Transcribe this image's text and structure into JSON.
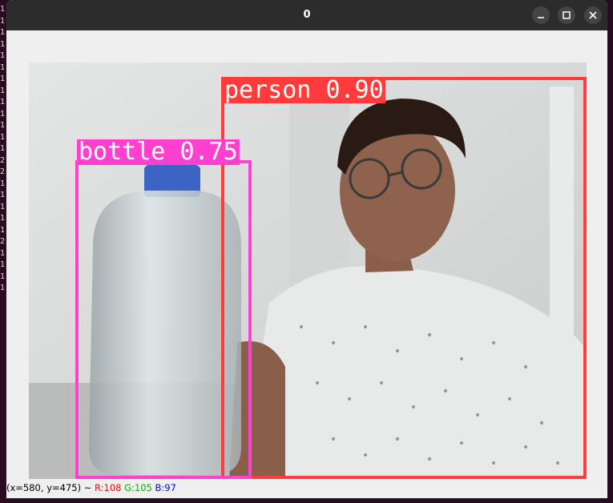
{
  "window": {
    "title": "0"
  },
  "terminal": {
    "lines": [
      "1",
      "1",
      "1",
      "1",
      "1",
      "1",
      "1",
      "1",
      "1",
      "1",
      "1",
      "1",
      "1",
      "2",
      "2",
      "1",
      "1",
      "1",
      "1",
      "1",
      "2",
      "1",
      "1",
      "1",
      "1"
    ]
  },
  "detections": [
    {
      "label": "person",
      "score": "0.90",
      "color": "#ff3b3b"
    },
    {
      "label": "bottle",
      "score": "0.75",
      "color": "#ff3fd0"
    }
  ],
  "status": {
    "coords": "(x=580, y=475) ~",
    "r": "R:108",
    "g": "G:105",
    "b": "B:97",
    "r_color": "#ff0000",
    "g_color": "#00b000",
    "b_color": "#0000ff"
  }
}
